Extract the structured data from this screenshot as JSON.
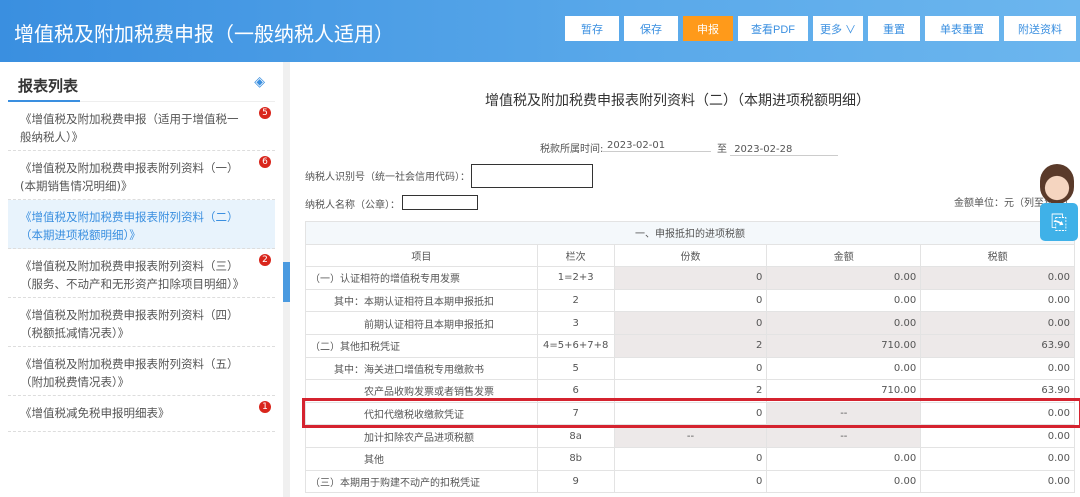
{
  "header": {
    "title": "增值税及附加税费申报（一般纳税人适用）",
    "buttons": [
      "暂存",
      "保存",
      "申报",
      "查看PDF",
      "更多 ∨",
      "重置",
      "单表重置",
      "附送资料"
    ]
  },
  "sidebar": {
    "title": "报表列表",
    "items": [
      {
        "label": "《增值税及附加税费申报（适用于增值税一般纳税人）》",
        "badge": "5"
      },
      {
        "label": "《增值税及附加税费申报表附列资料（一）(本期销售情况明细)》",
        "badge": "6"
      },
      {
        "label": "《增值税及附加税费申报表附列资料（二）（本期进项税额明细）》",
        "badge": ""
      },
      {
        "label": "《增值税及附加税费申报表附列资料（三）（服务、不动产和无形资产扣除项目明细）》",
        "badge": "2"
      },
      {
        "label": "《增值税及附加税费申报表附列资料（四）（税额抵减情况表）》",
        "badge": ""
      },
      {
        "label": "《增值税及附加税费申报表附列资料（五）（附加税费情况表）》",
        "badge": ""
      },
      {
        "label": "《增值税减免税申报明细表》",
        "badge": "1"
      }
    ]
  },
  "main": {
    "title": "增值税及附加税费申报表附列资料（二）（本期进项税额明细）",
    "period_label": "税款所属时间:",
    "period_start": "2023-02-01",
    "period_to": "至",
    "period_end": "2023-02-28",
    "taxpayer_id_label": "纳税人识别号（统一社会信用代码）：",
    "taxpayer_name_label": "纳税人名称（公章）：",
    "unit_label": "金额单位：元（列至角分）",
    "section_title": "一、申报抵扣的进项税额",
    "columns": [
      "项目",
      "栏次",
      "份数",
      "金额",
      "税额"
    ],
    "rows": [
      {
        "item": "（一）认证相符的增值税专用发票",
        "line": "1=2+3",
        "count": "0",
        "amount": "0.00",
        "tax": "0.00",
        "indent": 1,
        "gray": [
          1,
          1,
          1
        ]
      },
      {
        "item": "其中：本期认证相符且本期申报抵扣",
        "line": "2",
        "count": "0",
        "amount": "0.00",
        "tax": "0.00",
        "indent": 2,
        "gray": [
          0,
          0,
          0
        ]
      },
      {
        "item": "前期认证相符且本期申报抵扣",
        "line": "3",
        "count": "0",
        "amount": "0.00",
        "tax": "0.00",
        "indent": 3,
        "gray": [
          1,
          1,
          1
        ]
      },
      {
        "item": "（二）其他扣税凭证",
        "line": "4=5+6+7+8",
        "count": "2",
        "amount": "710.00",
        "tax": "63.90",
        "indent": 1,
        "gray": [
          1,
          1,
          1
        ]
      },
      {
        "item": "其中：海关进口增值税专用缴款书",
        "line": "5",
        "count": "0",
        "amount": "0.00",
        "tax": "0.00",
        "indent": 2,
        "gray": [
          0,
          0,
          0
        ]
      },
      {
        "item": "农产品收购发票或者销售发票",
        "line": "6",
        "count": "2",
        "amount": "710.00",
        "tax": "63.90",
        "indent": 3,
        "gray": [
          0,
          0,
          0
        ]
      },
      {
        "item": "代扣代缴税收缴款凭证",
        "line": "7",
        "count": "0",
        "amount": "--",
        "tax": "0.00",
        "indent": 3,
        "gray": [
          0,
          1,
          0
        ]
      },
      {
        "item": "加计扣除农产品进项税额",
        "line": "8a",
        "count": "--",
        "amount": "--",
        "tax": "0.00",
        "indent": 3,
        "gray": [
          1,
          1,
          0
        ]
      },
      {
        "item": "其他",
        "line": "8b",
        "count": "0",
        "amount": "0.00",
        "tax": "0.00",
        "indent": 3,
        "gray": [
          0,
          0,
          0
        ]
      },
      {
        "item": "（三）本期用于购建不动产的扣税凭证",
        "line": "9",
        "count": "0",
        "amount": "0.00",
        "tax": "0.00",
        "indent": 1,
        "gray": [
          0,
          0,
          0
        ]
      }
    ]
  }
}
